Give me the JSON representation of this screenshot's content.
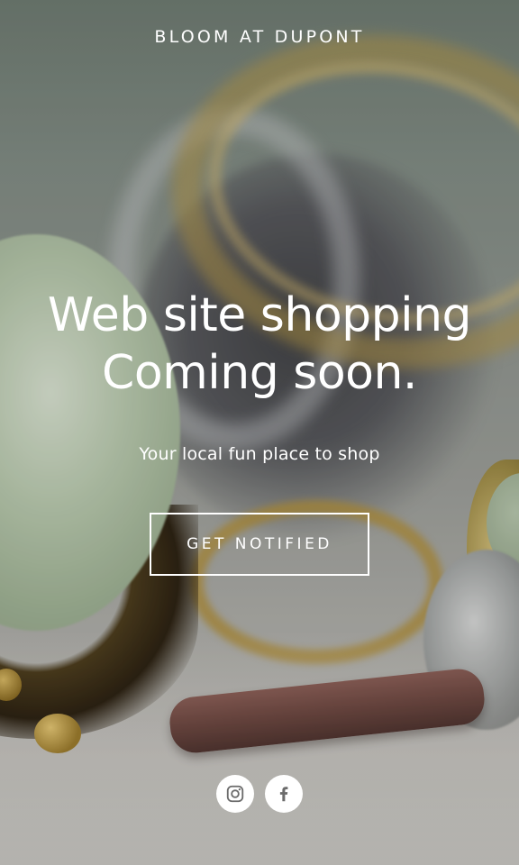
{
  "site": {
    "brand": "BLOOM AT DUPONT"
  },
  "hero": {
    "headline_line1": "Web site shopping",
    "headline_line2": "Coming soon.",
    "tagline": "Your local fun place to shop",
    "cta_label": "GET NOTIFIED"
  },
  "social": {
    "icons": [
      "instagram-icon",
      "facebook-icon"
    ],
    "icon_color": "#6b6b6b",
    "background_color": "#ffffff"
  },
  "colors": {
    "text": "#ffffff",
    "button_border": "#ffffff"
  }
}
